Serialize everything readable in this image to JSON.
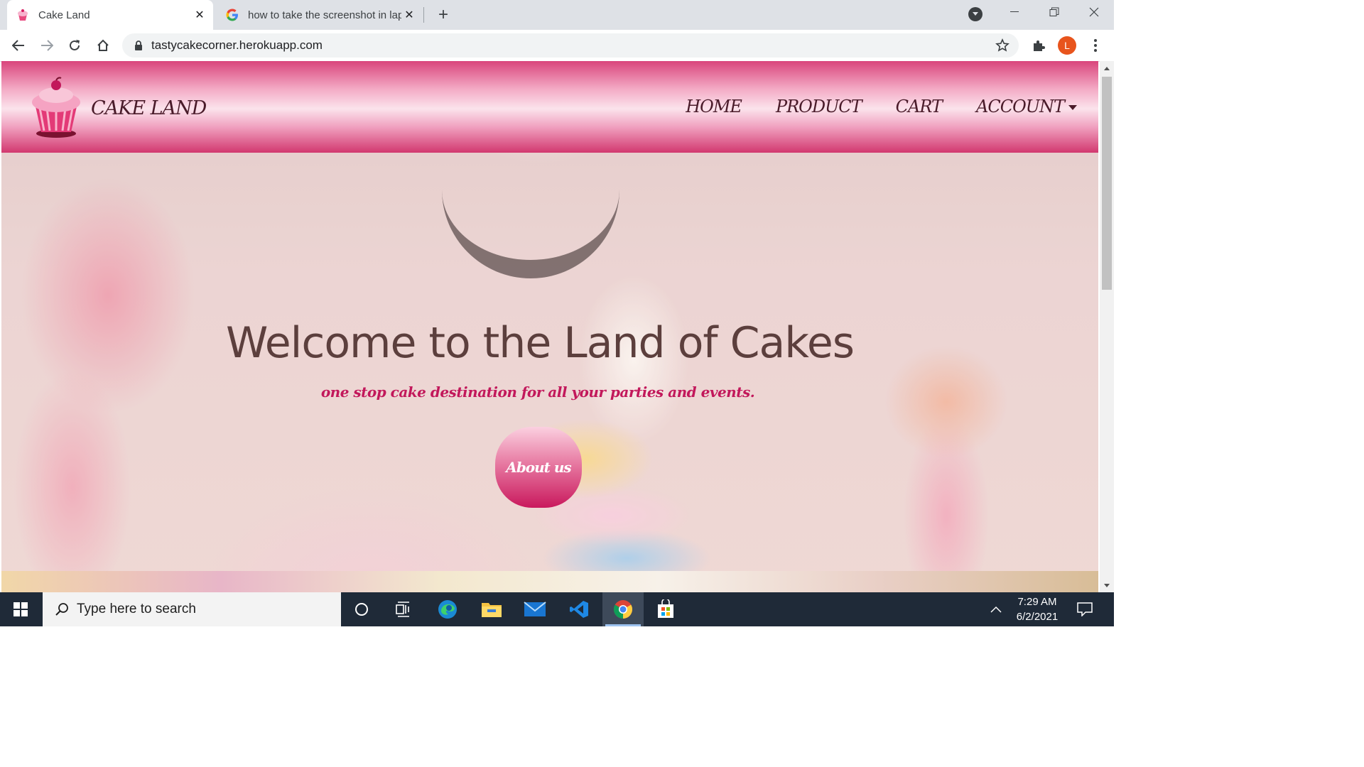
{
  "browser": {
    "tabs": [
      {
        "title": "Cake Land",
        "favicon": "cupcake-icon",
        "active": true
      },
      {
        "title": "how to take the screenshot in lap",
        "favicon": "google-g-icon",
        "active": false
      }
    ],
    "url": "tastycakecorner.herokuapp.com",
    "profile_initial": "L"
  },
  "site": {
    "brand": "CAKE LAND",
    "nav": [
      "HOME",
      "PRODUCT",
      "CART",
      "ACCOUNT"
    ],
    "hero": {
      "heading": "Welcome to the Land of Cakes",
      "tagline": "one stop cake destination for all your parties and events.",
      "button": "About us"
    },
    "colors": {
      "accent": "#c2185b",
      "navbar": "#d9457c",
      "text": "#4a1b2a"
    }
  },
  "taskbar": {
    "search_placeholder": "Type here to search",
    "apps": [
      "cortana-icon",
      "task-view-icon",
      "edge-icon",
      "file-explorer-icon",
      "mail-icon",
      "vscode-icon",
      "chrome-icon",
      "store-icon"
    ],
    "time": "7:29 AM",
    "date": "6/2/2021"
  }
}
